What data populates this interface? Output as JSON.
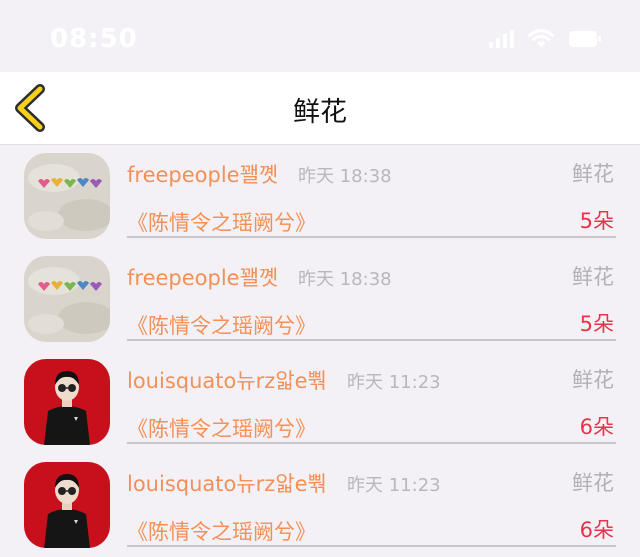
{
  "status_bar": {
    "time": "08:50"
  },
  "nav": {
    "title": "鲜花",
    "back_icon": "chevron-left-icon",
    "accent_color": "#f5d11c"
  },
  "colors": {
    "username": "#f39057",
    "quantity": "#e8334a",
    "muted": "#b3b0b6"
  },
  "records": [
    {
      "avatar": "hearts-avatar",
      "username": "freepeople꽬꼣",
      "time": "昨天 18:38",
      "gift": "鲜花",
      "drama": "《陈情令之瑶阙兮》",
      "quantity": "5朵"
    },
    {
      "avatar": "hearts-avatar",
      "username": "freepeople꽬꼣",
      "time": "昨天 18:38",
      "gift": "鲜花",
      "drama": "《陈情令之瑶阙兮》",
      "quantity": "5朵"
    },
    {
      "avatar": "person-avatar",
      "username": "louisquato뉴rz앏e뿪",
      "time": "昨天 11:23",
      "gift": "鲜花",
      "drama": "《陈情令之瑶阙兮》",
      "quantity": "6朵"
    },
    {
      "avatar": "person-avatar",
      "username": "louisquato뉴rz앏e뿪",
      "time": "昨天 11:23",
      "gift": "鲜花",
      "drama": "《陈情令之瑶阙兮》",
      "quantity": "6朵"
    }
  ]
}
